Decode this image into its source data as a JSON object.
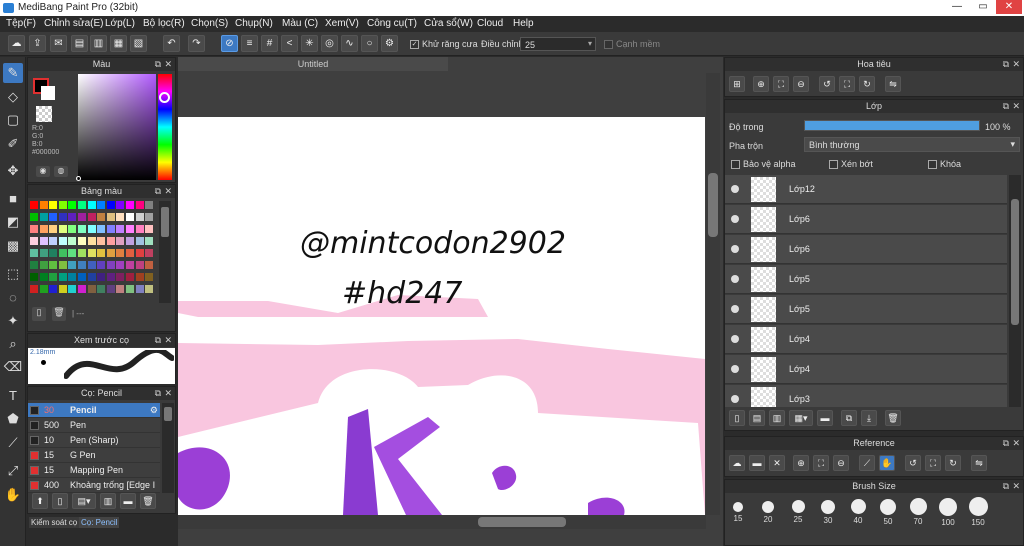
{
  "window": {
    "title": "MediBang Paint Pro (32bit)",
    "minimize": "—",
    "maximize": "▭",
    "close": "✕"
  },
  "menu": [
    "Tệp(F)",
    "Chỉnh sửa(E)",
    "Lớp(L)",
    "Bộ lọc(R)",
    "Chọn(S)",
    "Chụp(N)",
    "Màu (C)",
    "Xem(V)",
    "Công cụ(T)",
    "Cửa sổ(W)",
    "Cloud",
    "Help"
  ],
  "toolbar": {
    "antialias_label": "Khử răng cưa",
    "adjust_label": "Điều chỉnh",
    "adjust_value": "25",
    "soft_edge_label": "Cạnh mềm"
  },
  "color_panel": {
    "title": "Màu",
    "r": "R:0",
    "g": "G:0",
    "b": "B:0",
    "hex": "#000000",
    "primary": "#000000",
    "secondary": "#ffffff"
  },
  "palette_panel": {
    "title": "Bảng màu",
    "footer_text": "| ---"
  },
  "brush_preview": {
    "title": "Xem trước cọ",
    "size": "2.18mm"
  },
  "brush_panel": {
    "title": "Cọ: Pencil",
    "brushes": [
      {
        "size": "30",
        "name": "Pencil",
        "color": "#222222"
      },
      {
        "size": "500",
        "name": "Pen",
        "color": "#222222"
      },
      {
        "size": "10",
        "name": "Pen (Sharp)",
        "color": "#222222"
      },
      {
        "size": "15",
        "name": "G Pen",
        "color": "#e03030"
      },
      {
        "size": "15",
        "name": "Mapping Pen",
        "color": "#e03030"
      },
      {
        "size": "400",
        "name": "Khoảng trống [Edge I",
        "color": "#e03030"
      }
    ]
  },
  "bottom_tabs": {
    "tab1": "Kiểm soát cọ",
    "tab2": "Cọ: Pencil"
  },
  "document": {
    "tab": "Untitled",
    "handwriting_line1": "@mintcodon2902",
    "handwriting_line2": "#hd247"
  },
  "navigator": {
    "title": "Hoa tiêu"
  },
  "layer_panel": {
    "title": "Lớp",
    "opacity_label": "Độ trong",
    "opacity_value": 100,
    "opacity_text": "100 %",
    "blend_label": "Pha trộn",
    "blend_value": "Bình thường",
    "protect_alpha": "Bảo vệ alpha",
    "clipping": "Xén bớt",
    "lock": "Khóa",
    "layers": [
      "Lớp12",
      "Lớp6",
      "Lớp6",
      "Lớp5",
      "Lớp5",
      "Lớp4",
      "Lớp4",
      "Lớp3"
    ]
  },
  "reference_panel": {
    "title": "Reference"
  },
  "brush_size_panel": {
    "title": "Brush Size",
    "sizes": [
      "15",
      "20",
      "25",
      "30",
      "40",
      "50",
      "70",
      "100",
      "150"
    ]
  },
  "colors": {
    "accent": "#3d79c2",
    "canvas_pink": "#f9c6df",
    "purple": "#9b3fd6"
  },
  "icons": [
    "pen-icon",
    "eraser-icon",
    "select-rect-icon",
    "transform-icon",
    "bucket-icon",
    "text-icon",
    "eyedropper-icon",
    "hand-icon",
    "hidden-eye-icon",
    "trash-icon",
    "folder-icon"
  ]
}
